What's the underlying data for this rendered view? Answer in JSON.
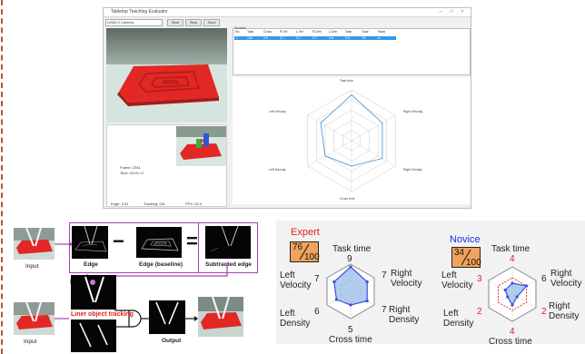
{
  "app": {
    "title": "Tabletop Teaching Evaluator",
    "source_combo": "USB2.0 Camera",
    "buttons": [
      "Start",
      "Stop",
      "Save"
    ],
    "table_caption": "Scores",
    "table_headers": [
      "No.",
      "Task",
      "Cross",
      "R.Vel",
      "L.Vel",
      "R.Den",
      "L.Den",
      "Task",
      "Total",
      "Rank"
    ],
    "table_row": [
      "1",
      "100",
      "0.5",
      "0.7",
      "0.7",
      "0.7",
      "0.6",
      "0.9",
      "76",
      "A"
    ],
    "radar_labels": {
      "top": "Task time",
      "upper_right": "Right Velocity",
      "lower_right": "Right Density",
      "bottom": "Cross time",
      "lower_left": "Left Density",
      "upper_left": "Left Velocity"
    },
    "lower_text": [
      "Frame: 2341",
      "Time: 00:01:17"
    ],
    "lower_footer": [
      "Edge: 0.51",
      "Tracking: ON",
      "FPS: 29.9"
    ]
  },
  "pipeline": {
    "input_top": "Input",
    "edge": "Edge",
    "edge_baseline": "Edge (baseline)",
    "subtracted_edge": "Subtracted edge",
    "minus": "−",
    "equals": "=",
    "input_bottom": "Input",
    "liner_tracking": "Liner object tracking",
    "output": "Output"
  },
  "expert": {
    "title": "Expert",
    "score": "76",
    "max": "100",
    "task_time": "Task time",
    "task_time_val": "9",
    "right_velocity": "Right\nVelocity",
    "right_velocity_val": "7",
    "right_density": "Right\nDensity",
    "right_density_val": "7",
    "cross_time": "Cross time",
    "cross_time_val": "5",
    "left_density": "Left\nDensity",
    "left_density_val": "6",
    "left_velocity": "Left\nVelocity",
    "left_velocity_val": "7",
    "values": [
      9,
      7,
      7,
      5,
      6,
      7
    ],
    "baseline": [
      4,
      4,
      4,
      4,
      4,
      4
    ]
  },
  "novice": {
    "title": "Novice",
    "score": "34",
    "max": "100",
    "task_time": "Task time",
    "task_time_val": "4",
    "right_velocity": "Right\nVelocity",
    "right_velocity_val": "6",
    "right_density": "Right\nDensity",
    "right_density_val": "2",
    "cross_time": "Cross time",
    "cross_time_val": "4",
    "left_density": "Left\nDensity",
    "left_density_val": "2",
    "left_velocity": "Left\nVelocity",
    "left_velocity_val": "3",
    "values": [
      4,
      6,
      2,
      4,
      2,
      3
    ],
    "baseline": [
      6,
      6,
      6,
      6,
      6,
      6
    ]
  },
  "colors": {
    "expert_title": "#e02020",
    "novice_title": "#1c2ee8",
    "fill": "#a8c8ec",
    "stroke": "#3b4fe0",
    "baseline": "#e02020",
    "frame": "#a640b0",
    "score_bg": "#f0a35c",
    "red_path": "#e43a2c"
  }
}
